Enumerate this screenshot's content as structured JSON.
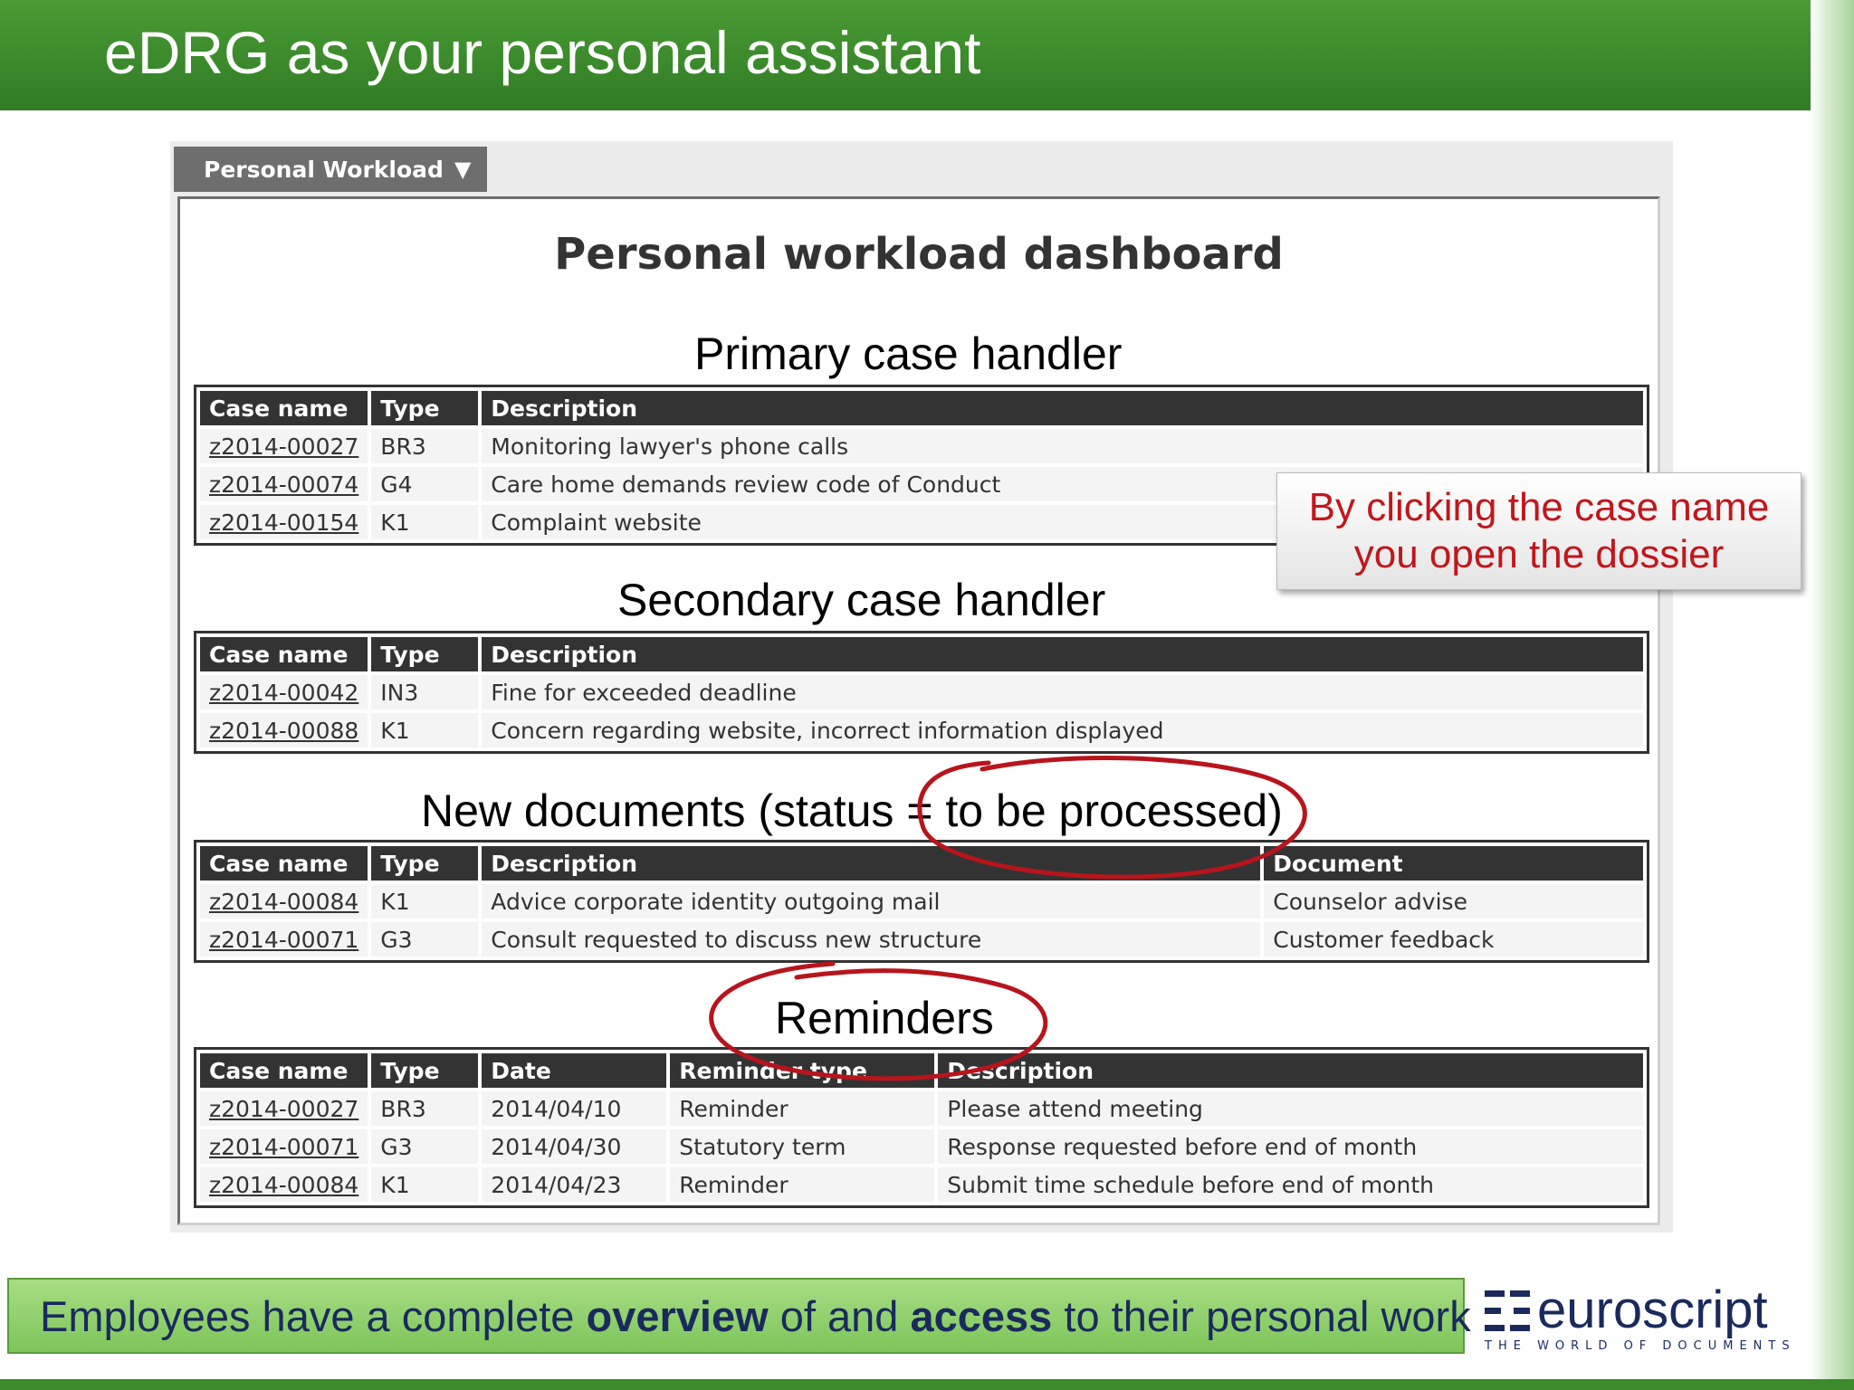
{
  "slide": {
    "title": "eDRG as your personal assistant"
  },
  "app": {
    "tab_label": "Personal Workload",
    "tab_caret": "▼",
    "dashboard_title": "Personal workload dashboard"
  },
  "primary": {
    "heading": "Primary case handler",
    "columns": [
      "Case name",
      "Type",
      "Description"
    ],
    "rows": [
      {
        "case": "z2014-00027",
        "type": "BR3",
        "description": "Monitoring lawyer's phone calls"
      },
      {
        "case": "z2014-00074",
        "type": "G4",
        "description": "Care home demands review code of Conduct"
      },
      {
        "case": "z2014-00154",
        "type": "K1",
        "description": "Complaint website"
      }
    ]
  },
  "secondary": {
    "heading": "Secondary case handler",
    "columns": [
      "Case name",
      "Type",
      "Description"
    ],
    "rows": [
      {
        "case": "z2014-00042",
        "type": "IN3",
        "description": "Fine for exceeded deadline"
      },
      {
        "case": "z2014-00088",
        "type": "K1",
        "description": "Concern regarding website, incorrect information displayed"
      }
    ]
  },
  "new_documents": {
    "heading": "New documents (status = to be processed)",
    "columns": [
      "Case name",
      "Type",
      "Description",
      "Document"
    ],
    "rows": [
      {
        "case": "z2014-00084",
        "type": "K1",
        "description": "Advice corporate identity outgoing mail",
        "document": "Counselor advise"
      },
      {
        "case": "z2014-00071",
        "type": "G3",
        "description": "Consult requested to discuss new structure",
        "document": "Customer feedback"
      }
    ]
  },
  "reminders": {
    "heading": "Reminders",
    "columns": [
      "Case name",
      "Type",
      "Date",
      "Reminder type",
      "Description"
    ],
    "rows": [
      {
        "case": "z2014-00027",
        "type": "BR3",
        "date": "2014/04/10",
        "reminder_type": "Reminder",
        "description": "Please attend meeting"
      },
      {
        "case": "z2014-00071",
        "type": "G3",
        "date": "2014/04/30",
        "reminder_type": "Statutory term",
        "description": "Response requested before end of month"
      },
      {
        "case": "z2014-00084",
        "type": "K1",
        "date": "2014/04/23",
        "reminder_type": "Reminder",
        "description": "Submit time schedule before end of month"
      }
    ]
  },
  "callout": {
    "line1": "By clicking the case name",
    "line2": "you open the dossier"
  },
  "footer": {
    "text_1": "Employees have a complete ",
    "bold_1": "overview",
    "text_2": " of and ",
    "bold_2": "access",
    "text_3": " to their personal work"
  },
  "logo": {
    "word": "euroscript",
    "tagline": "THE WORLD OF DOCUMENTS"
  },
  "colors": {
    "header_green": "#3a8a2b",
    "annotation_red": "#c0171c",
    "table_header": "#333333",
    "brand_navy": "#1a2a5c"
  }
}
